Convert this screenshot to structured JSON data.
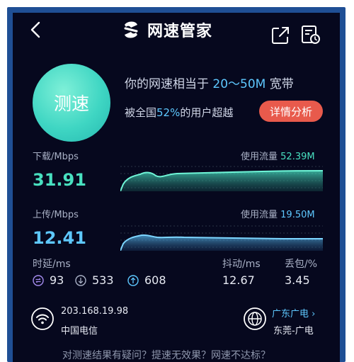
{
  "header": {
    "title": "网速管家"
  },
  "speedtest": {
    "button_label": "测速",
    "equiv_prefix": "你的网速相当于 ",
    "equiv_value": "20～50M",
    "equiv_suffix": " 宽带",
    "beat_prefix": "被全国",
    "beat_value": "52%",
    "beat_suffix": "的用户超越",
    "detail_button": "详情分析"
  },
  "download": {
    "label": "下载/Mbps",
    "value": "31.91",
    "usage_label": "使用流量",
    "usage_value": "52.39M"
  },
  "upload": {
    "label": "上传/Mbps",
    "value": "12.41",
    "usage_label": "使用流量",
    "usage_value": "19.50M"
  },
  "latency": {
    "label": "时延",
    "unit": "/ms",
    "values": [
      "93",
      "533",
      "608"
    ]
  },
  "jitter": {
    "label": "抖动",
    "unit": "/ms",
    "value": "12.67"
  },
  "loss": {
    "label": "丢包",
    "unit": "/%",
    "value": "3.45"
  },
  "network": {
    "ip": "203.168.19.98",
    "isp": "中国电信",
    "region_provider": "广东广电",
    "region": "东莞-广电"
  },
  "footer": {
    "text": "对测速结果有疑问？提速无效果？网速不达标？"
  },
  "colors": {
    "download_accent": "#48e0c0",
    "upload_accent": "#5ec8ff",
    "detail_button": "#e85a4c"
  }
}
